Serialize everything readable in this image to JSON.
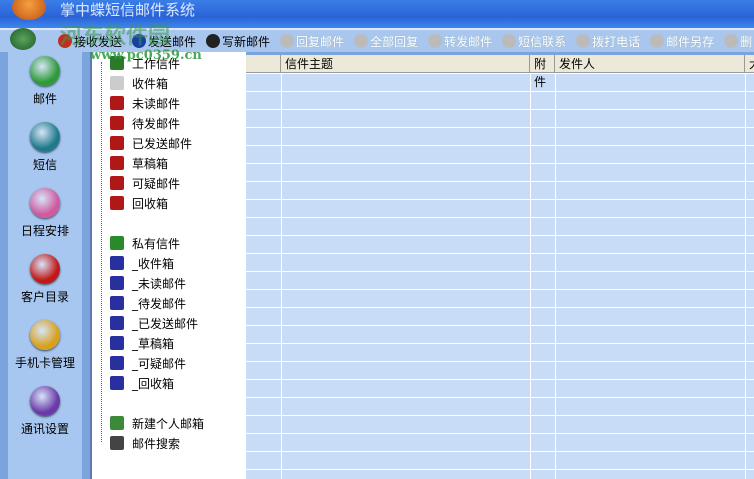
{
  "title": "掌中蝶短信邮件系统",
  "watermark": {
    "text": "河东软件园",
    "url": "www.pc0359.cn"
  },
  "toolbar": [
    {
      "label": "接收发送",
      "enabled": true,
      "icon": "send-receive-icon"
    },
    {
      "label": "发送邮件",
      "enabled": true,
      "icon": "send-mail-icon"
    },
    {
      "label": "写新邮件",
      "enabled": true,
      "icon": "compose-icon"
    },
    {
      "label": "回复邮件",
      "enabled": false,
      "icon": "reply-icon"
    },
    {
      "label": "全部回复",
      "enabled": false,
      "icon": "reply-all-icon"
    },
    {
      "label": "转发邮件",
      "enabled": false,
      "icon": "forward-icon"
    },
    {
      "label": "短信联系",
      "enabled": false,
      "icon": "sms-icon"
    },
    {
      "label": "拨打电话",
      "enabled": false,
      "icon": "phone-icon"
    },
    {
      "label": "邮件另存",
      "enabled": false,
      "icon": "save-as-icon"
    },
    {
      "label": "删",
      "enabled": false,
      "icon": "delete-icon"
    }
  ],
  "sidebar": [
    {
      "label": "邮件",
      "color": "#2f9a3a"
    },
    {
      "label": "短信",
      "color": "#1e7a8a"
    },
    {
      "label": "日程安排",
      "color": "#d05aa0"
    },
    {
      "label": "客户目录",
      "color": "#c01818"
    },
    {
      "label": "手机卡管理",
      "color": "#d8a020"
    },
    {
      "label": "通讯设置",
      "color": "#6a3aa8"
    }
  ],
  "tree": {
    "work": {
      "label": "工作信件",
      "children": [
        "收件箱",
        "未读邮件",
        "待发邮件",
        "已发送邮件",
        "草稿箱",
        "可疑邮件",
        "回收箱"
      ]
    },
    "private": {
      "label": "私有信件",
      "children": [
        "_收件箱",
        "_未读邮件",
        "_待发邮件",
        "_已发送邮件",
        "_草稿箱",
        "_可疑邮件",
        "_回收箱"
      ]
    },
    "new_mailbox": "新建个人邮箱",
    "search": "邮件搜索"
  },
  "table": {
    "columns": [
      "",
      "信件主题",
      "附件",
      "发件人",
      "大"
    ]
  }
}
